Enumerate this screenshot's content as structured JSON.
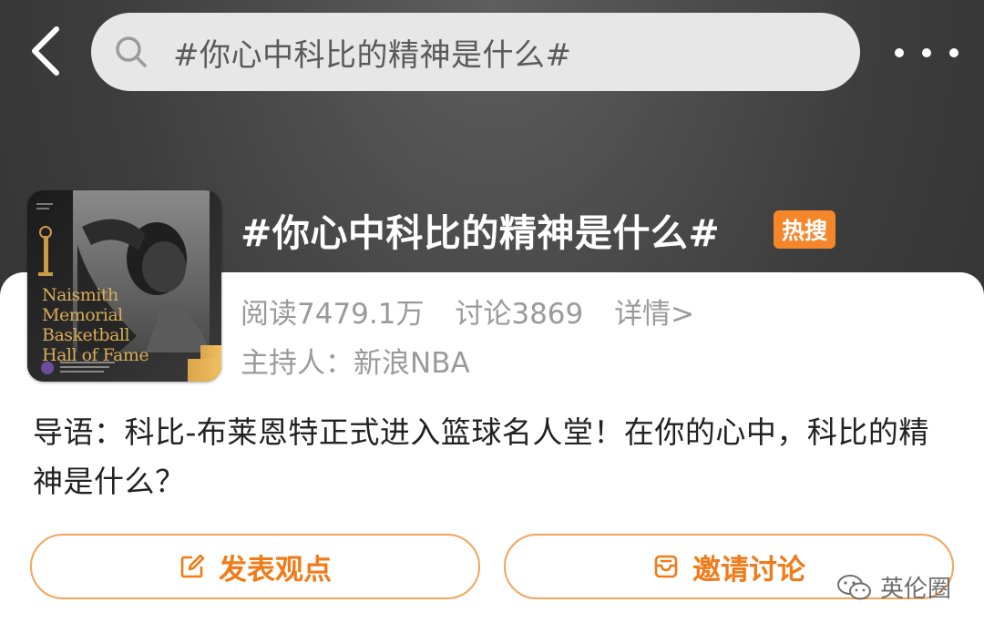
{
  "nav": {
    "search_text": "#你心中科比的精神是什么#"
  },
  "topic": {
    "title": "#你心中科比的精神是什么#",
    "badge": "热搜",
    "reads": "阅读7479.1万",
    "discussions": "讨论3869",
    "details_link": "详情>",
    "host": "主持人：新浪NBA",
    "intro": "导语：科比-布莱恩特正式进入篮球名人堂！在你的心中，科比的精神是什么？"
  },
  "cover": {
    "caption_lines": [
      "Naismith",
      "Memorial",
      "Basketball",
      "Hall of Fame"
    ]
  },
  "actions": {
    "post_label": "发表观点",
    "invite_label": "邀请讨论"
  },
  "watermark": {
    "text": "英伦圈"
  },
  "colors": {
    "accent": "#f07b18",
    "badge": "#f5862a",
    "button_border": "#f6a35a"
  }
}
